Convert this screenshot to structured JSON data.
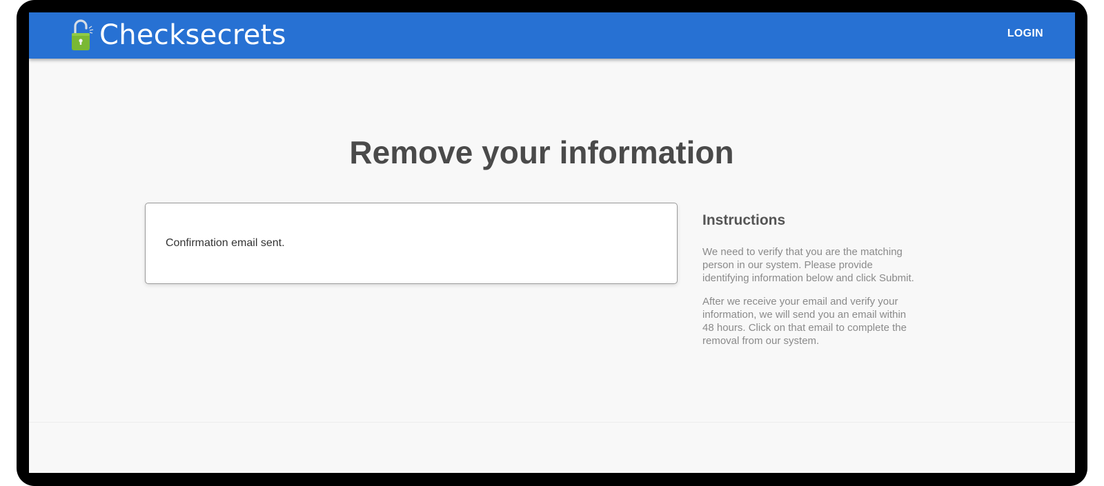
{
  "header": {
    "brand_name": "Checksecrets",
    "brand_icon": "open-padlock-icon",
    "login_label": "LOGIN",
    "colors": {
      "navbar": "#2771d3",
      "lock_body": "#7ab834"
    }
  },
  "main": {
    "title": "Remove your information",
    "status_message": "Confirmation email sent."
  },
  "instructions": {
    "heading": "Instructions",
    "paragraphs": [
      "We need to verify that you are the matching person in our system. Please provide identifying information below and click Submit.",
      "After we receive your email and verify your information, we will send you an email within 48 hours. Click on that email to complete the removal from our system."
    ]
  }
}
